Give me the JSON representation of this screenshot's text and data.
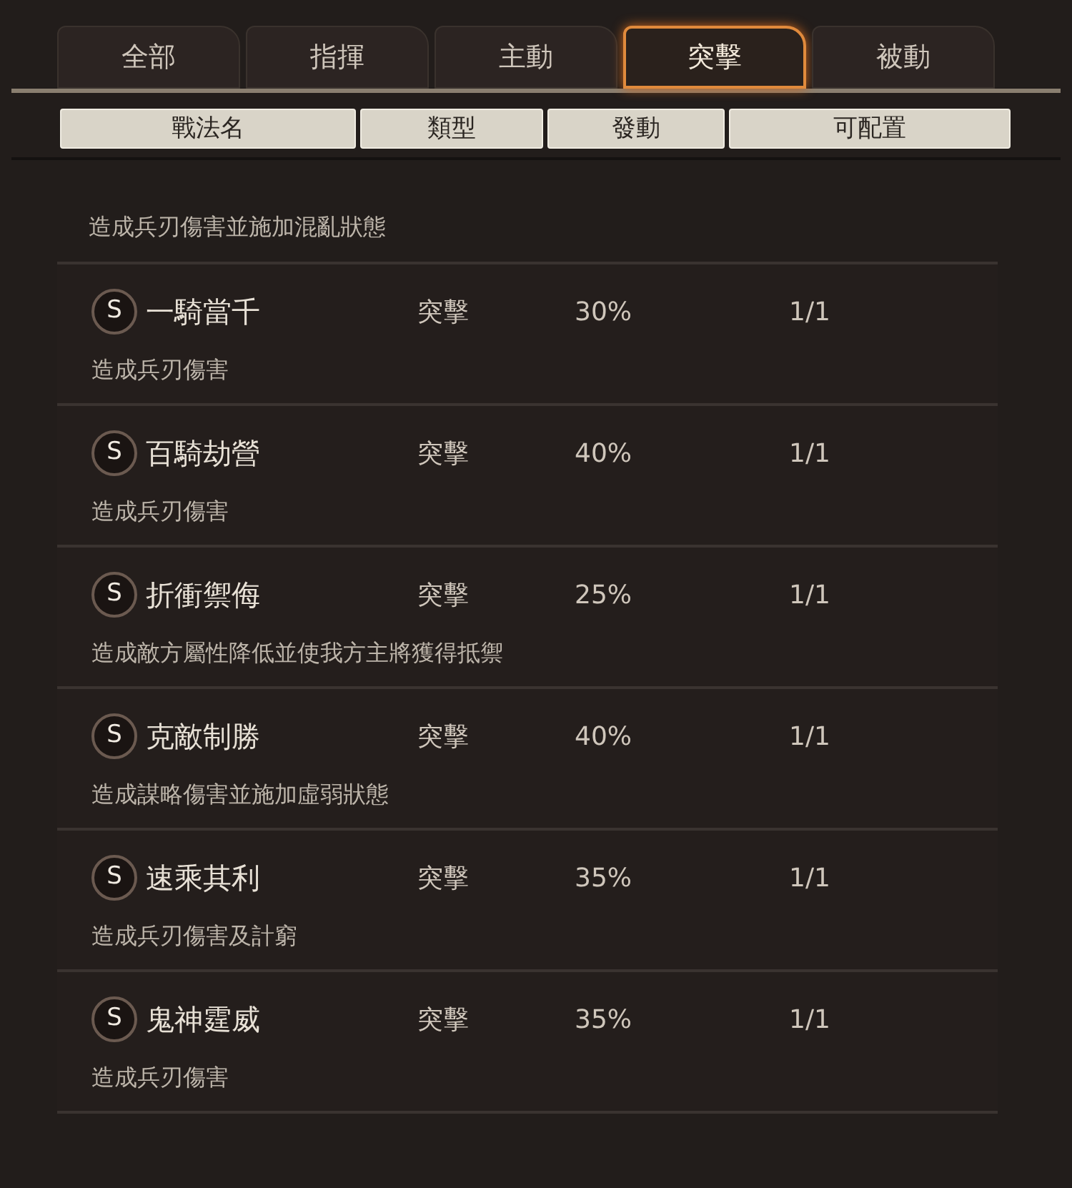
{
  "tabs": [
    {
      "label": "全部",
      "selected": false
    },
    {
      "label": "指揮",
      "selected": false
    },
    {
      "label": "主動",
      "selected": false
    },
    {
      "label": "突擊",
      "selected": true
    },
    {
      "label": "被動",
      "selected": false
    }
  ],
  "columns": [
    "戰法名",
    "類型",
    "發動",
    "可配置"
  ],
  "partial_description": "造成兵刃傷害並施加混亂狀態",
  "rows": [
    {
      "grade": "S",
      "name": "一騎當千",
      "type": "突擊",
      "rate": "30%",
      "config": "1/1",
      "description": "造成兵刃傷害"
    },
    {
      "grade": "S",
      "name": "百騎劫營",
      "type": "突擊",
      "rate": "40%",
      "config": "1/1",
      "description": "造成兵刃傷害"
    },
    {
      "grade": "S",
      "name": "折衝禦侮",
      "type": "突擊",
      "rate": "25%",
      "config": "1/1",
      "description": "造成敵方屬性降低並使我方主將獲得抵禦"
    },
    {
      "grade": "S",
      "name": "克敵制勝",
      "type": "突擊",
      "rate": "40%",
      "config": "1/1",
      "description": "造成謀略傷害並施加虛弱狀態"
    },
    {
      "grade": "S",
      "name": "速乘其利",
      "type": "突擊",
      "rate": "35%",
      "config": "1/1",
      "description": "造成兵刃傷害及計窮"
    },
    {
      "grade": "S",
      "name": "鬼神霆威",
      "type": "突擊",
      "rate": "35%",
      "config": "1/1",
      "description": "造成兵刃傷害"
    }
  ]
}
